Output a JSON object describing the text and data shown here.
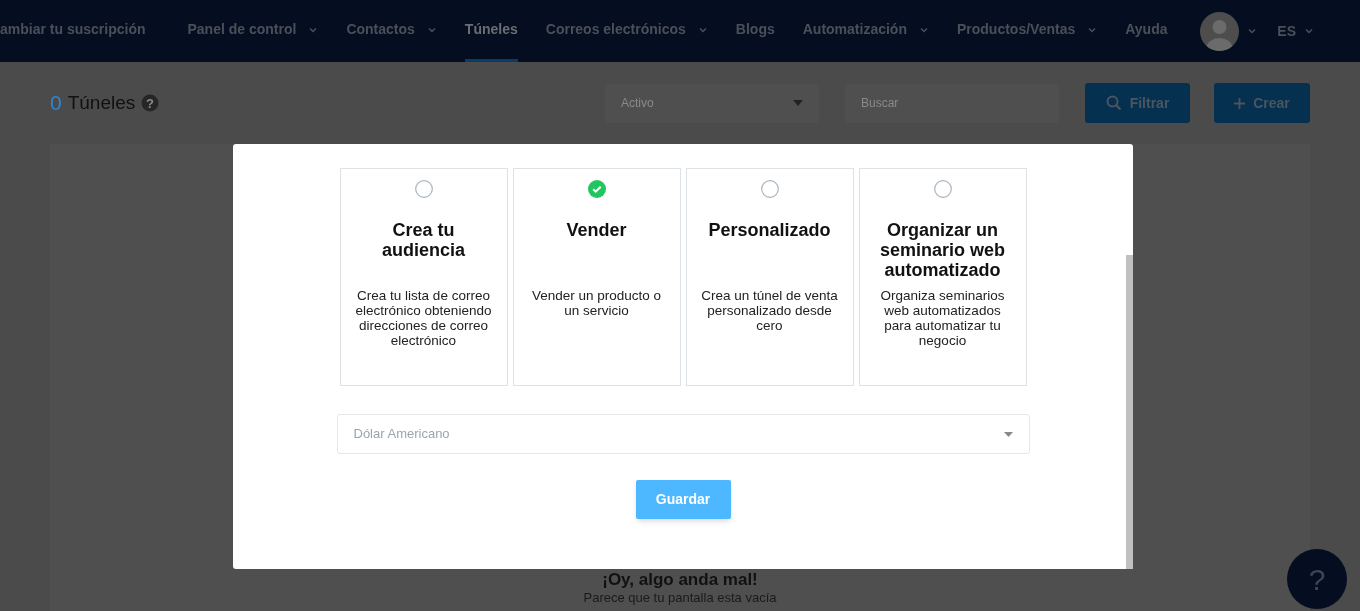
{
  "nav": {
    "items": [
      {
        "label": "ambiar tu suscripción",
        "dropdown": false,
        "selected": false
      },
      {
        "label": "Panel de control",
        "dropdown": true,
        "selected": false
      },
      {
        "label": "Contactos",
        "dropdown": true,
        "selected": false
      },
      {
        "label": "Túneles",
        "dropdown": false,
        "selected": true
      },
      {
        "label": "Correos electrónicos",
        "dropdown": true,
        "selected": false
      },
      {
        "label": "Blogs",
        "dropdown": false,
        "selected": false
      },
      {
        "label": "Automatización",
        "dropdown": true,
        "selected": false
      },
      {
        "label": "Productos/Ventas",
        "dropdown": true,
        "selected": false
      },
      {
        "label": "Ayuda",
        "dropdown": false,
        "selected": false
      }
    ],
    "language": "ES"
  },
  "header": {
    "count": "0",
    "title": "Túneles",
    "status_select": "Activo",
    "search": {
      "placeholder": "Buscar"
    },
    "filter_button": "Filtrar",
    "create_button": "Crear"
  },
  "empty_state": {
    "title": "¡Oy, algo anda mal!",
    "message": "Parece que tu pantalla esta vacía"
  },
  "modal": {
    "options": [
      {
        "title": "Crea tu audiencia",
        "description": "Crea tu lista de correo electrónico obteniendo direcciones de correo electrónico",
        "selected": false
      },
      {
        "title": "Vender",
        "description": "Vender un producto o un servicio",
        "selected": true
      },
      {
        "title": "Personalizado",
        "description": "Crea un túnel de venta personalizado desde cero",
        "selected": false
      },
      {
        "title": "Organizar un seminario web automatizado",
        "description": "Organiza seminarios web automatizados para automatizar tu negocio",
        "selected": false
      }
    ],
    "currency": "Dólar Americano",
    "save_button": "Guardar"
  },
  "help_button": "?"
}
